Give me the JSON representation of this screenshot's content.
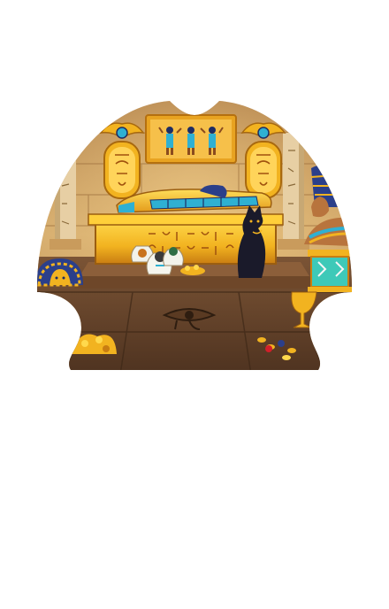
{
  "scene": {
    "name": "egyptian-tomb-chamber",
    "colors": {
      "sky_wall": "#c79a5c",
      "wall_light": "#d9b273",
      "wall_shadow": "#8b5e34",
      "floor": "#6e4a2e",
      "floor_dark": "#4e3220",
      "gold": "#f2b320",
      "gold_light": "#ffd84a",
      "gold_dark": "#c97d12",
      "turquoise": "#38b6d8",
      "navy": "#1f2d63",
      "black_cat": "#1a1a2a",
      "white": "#ffffff"
    },
    "icons": [
      "sarcophagus-icon",
      "cartouche-left-icon",
      "cartouche-right-icon",
      "wall-relief-icon",
      "bastet-cat-statue-icon",
      "canopic-jars-icon",
      "pharaoh-mask-icon",
      "nefertiti-bust-icon",
      "eye-of-horus-icon",
      "gold-coins-icon",
      "lantern-icon",
      "stone-column-icon"
    ]
  }
}
